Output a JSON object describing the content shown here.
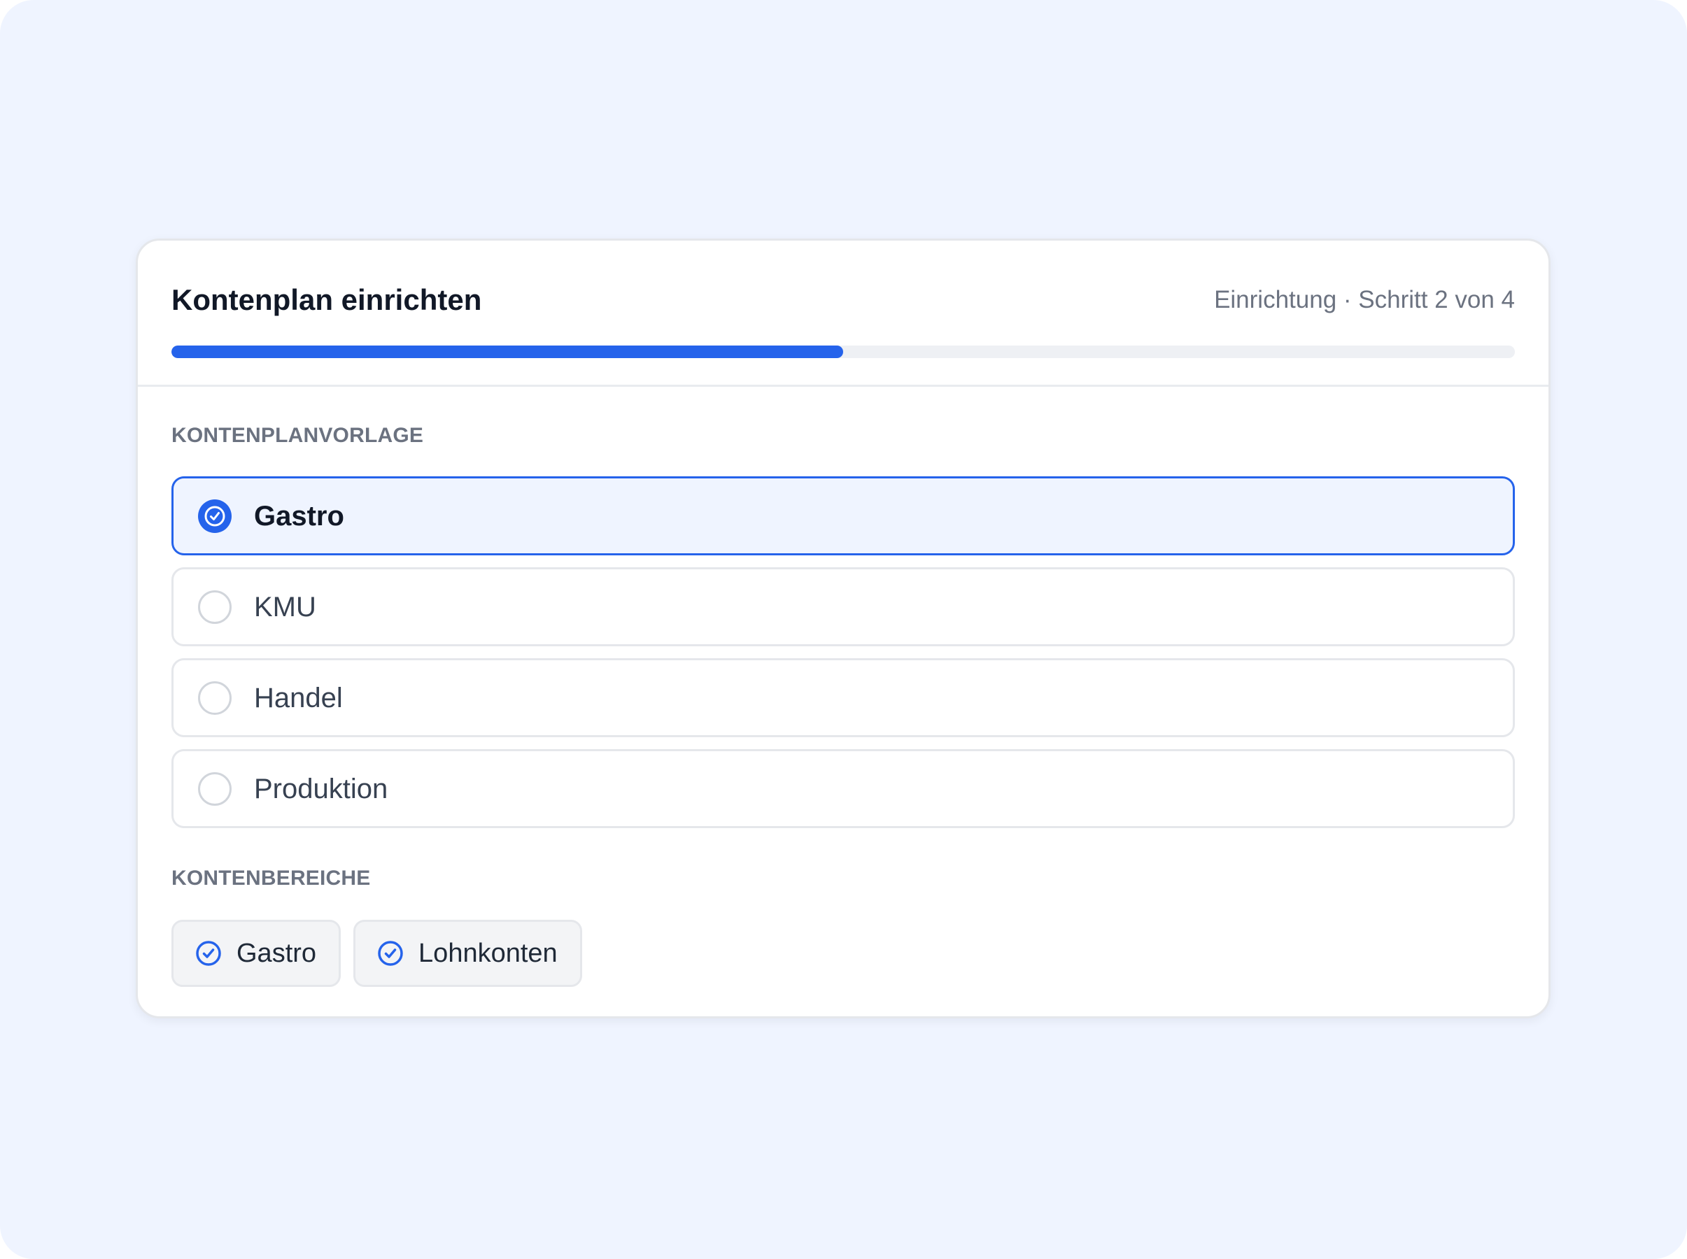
{
  "header": {
    "title": "Kontenplan einrichten",
    "step_meta": "Einrichtung · Schritt 2 von 4",
    "progress_fraction": 0.5
  },
  "templates_section": {
    "label": "KONTENPLANVORLAGE",
    "options": [
      {
        "label": "Gastro",
        "selected": true
      },
      {
        "label": "KMU",
        "selected": false
      },
      {
        "label": "Handel",
        "selected": false
      },
      {
        "label": "Produktion",
        "selected": false
      }
    ]
  },
  "ranges_section": {
    "label": "KONTENBEREICHE",
    "chips": [
      {
        "label": "Gastro",
        "checked": true
      },
      {
        "label": "Lohnkonten",
        "checked": true
      }
    ]
  },
  "colors": {
    "accent": "#2563eb",
    "page_background": "#eff4ff",
    "selected_background": "#eff4ff",
    "muted_text": "#6b7280"
  },
  "icons": {
    "radio_selected": "check-circle-icon",
    "radio_unselected": "empty-radio-icon",
    "chip_checked": "check-circle-outline-icon"
  }
}
